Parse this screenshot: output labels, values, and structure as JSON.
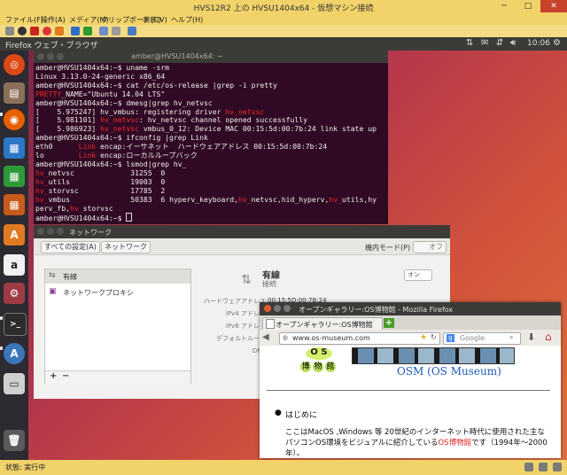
{
  "host": {
    "title": "HVS12R2 上の HVSU1404x64 - 仮想マシン接続",
    "menu": [
      "ファイル(F)",
      "操作(A)",
      "メディア(M)",
      "クリップボード(C)",
      "表示(V)",
      "ヘルプ(H)"
    ],
    "status": "状態: 実行中",
    "minimize": "─",
    "maximize": "□",
    "close": "✕"
  },
  "panel": {
    "app_title": "Firefox ウェブ・ブラウザ",
    "clock": "10:06"
  },
  "launcher": {
    "icons": [
      "ubuntu-logo-icon",
      "files-icon",
      "firefox-icon",
      "libreoffice-writer-icon",
      "libreoffice-calc-icon",
      "libreoffice-impress-icon",
      "software-center-icon",
      "amazon-icon",
      "system-settings-icon",
      "terminal-icon",
      "software-updater-icon",
      "disk-drive-icon",
      "trash-icon"
    ]
  },
  "terminal": {
    "title": "amber@HVSU1404x64: ~",
    "lines": [
      [
        {
          "t": "amber@HVSU1404x64:~$ uname -srm"
        }
      ],
      [
        {
          "t": "Linux 3.13.0-24-generic x86_64"
        }
      ],
      [
        {
          "t": "amber@HVSU1404x64:~$ cat /etc/os-release |grep -i pretty"
        }
      ],
      [
        {
          "t": "PRETTY",
          "c": "red"
        },
        {
          "t": "_NAME=\"Ubuntu 14.04 LTS\""
        }
      ],
      [
        {
          "t": "amber@HVSU1404x64:~$ dmesg|grep hv_netvsc"
        }
      ],
      [
        {
          "t": "[    5.975247] hv_vmbus: registering driver "
        },
        {
          "t": "hv_netvsc",
          "c": "red"
        }
      ],
      [
        {
          "t": "[    5.981101] "
        },
        {
          "t": "hv_netvsc",
          "c": "red"
        },
        {
          "t": ": hv_netvsc channel opened successfully"
        }
      ],
      [
        {
          "t": "[    5.986923] "
        },
        {
          "t": "hv_netvsc",
          "c": "red"
        },
        {
          "t": " vmbus_0_12: Device MAC 00:15:5d:00:7b:24 link state up"
        }
      ],
      [
        {
          "t": "amber@HVSU1404x64:~$ ifconfig |grep Link"
        }
      ],
      [
        {
          "t": "eth0      "
        },
        {
          "t": "Link",
          "c": "red"
        },
        {
          "t": " encap:イーサネット  ハードウェアアドレス 00:15:5d:00:7b:24"
        }
      ],
      [
        {
          "t": "lo        "
        },
        {
          "t": "Link",
          "c": "red"
        },
        {
          "t": " encap:ローカルループバック"
        }
      ],
      [
        {
          "t": "amber@HVSU1404x64:~$ lsmod|grep hv_"
        }
      ],
      [
        {
          "t": "hv_",
          "c": "red"
        },
        {
          "t": "netvsc             31255  0"
        }
      ],
      [
        {
          "t": "hv_",
          "c": "red"
        },
        {
          "t": "utils              19003  0"
        }
      ],
      [
        {
          "t": "hv_",
          "c": "red"
        },
        {
          "t": "storvsc            17785  2"
        }
      ],
      [
        {
          "t": "hv_",
          "c": "red"
        },
        {
          "t": "vmbus              50383  6 hyperv_keyboard,"
        },
        {
          "t": "hv_",
          "c": "red"
        },
        {
          "t": "netvsc,hid_hyperv,"
        },
        {
          "t": "hv_",
          "c": "red"
        },
        {
          "t": "utils,hy"
        }
      ],
      [
        {
          "t": "perv_fb,"
        },
        {
          "t": "hv_",
          "c": "red"
        },
        {
          "t": "storvsc"
        }
      ],
      [
        {
          "t": "amber@HVSU1404x64:~$ "
        }
      ]
    ]
  },
  "network": {
    "title": "ネットワーク",
    "all_settings": "すべての設定(A)",
    "breadcrumb": "ネットワーク",
    "airplane_label": "機内モード(P)",
    "airplane_state": "オフ",
    "list": [
      "有線",
      "ネットワークプロキシ"
    ],
    "add": "+",
    "remove": "−",
    "wired_title": "有線",
    "wired_status": "接続",
    "wired_toggle": "オン",
    "fields": [
      {
        "label": "ハードウェアアドレス",
        "value": "00:15:5D:00:7B:24"
      },
      {
        "label": "IPv4 アドレス",
        "value": ""
      },
      {
        "label": "IPv6 アドレス",
        "value": ""
      },
      {
        "label": "デフォルトルート",
        "value": ""
      },
      {
        "label": "DNS",
        "value": ""
      }
    ]
  },
  "firefox": {
    "title": "オープンギャラリー:OS博物館 - Mozilla Firefox",
    "tab_label": "オープンギャラリー:OS博物館",
    "new_tab": "+",
    "url": "www.os-museum.com",
    "search_placeholder": "Google",
    "logo_os": "O S",
    "logo_chars": [
      "博",
      "物",
      "館"
    ],
    "site_title": "OSM (OS Museum)",
    "heading": "はじめに",
    "para_before": "ここはMacOS ,Windows 等 20世紀のインターネット時代に使用された主なパソコンOS環境をビジュアルに紹介している",
    "para_link": "OS博物館",
    "para_after": "です（1994年〜2000年）。"
  },
  "colors": {
    "ubuntu_orange": "#dd4814",
    "terminal_bg": "#300a24",
    "link_red": "#ef2929"
  }
}
